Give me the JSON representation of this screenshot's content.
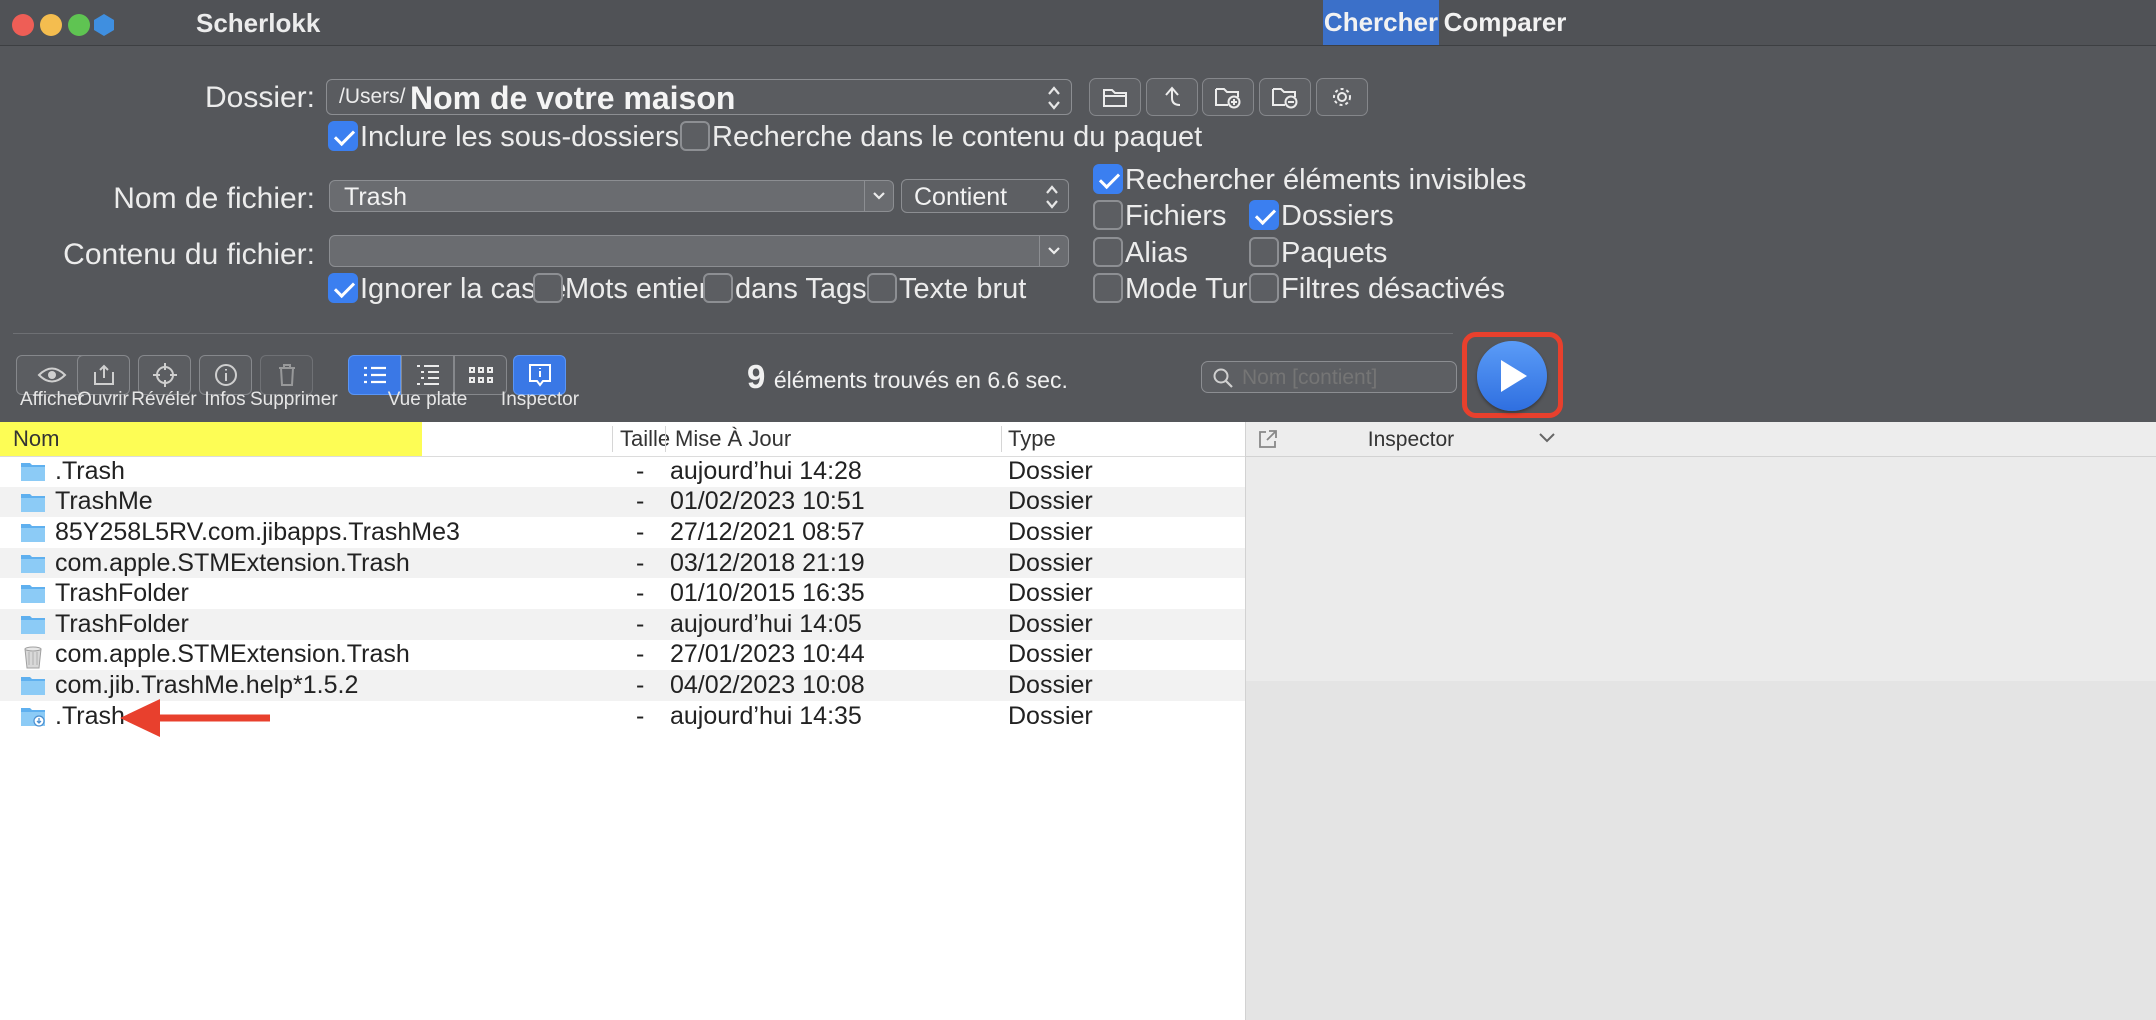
{
  "window": {
    "title": "Scherlokk",
    "tabs": [
      {
        "label": "Chercher",
        "active": true
      },
      {
        "label": "Comparer",
        "active": false
      }
    ]
  },
  "form": {
    "folder": {
      "label": "Dossier:",
      "prefix": "/Users/",
      "value": "Nom de votre maison"
    },
    "include_subfolders": {
      "label": "Inclure les sous-dossiers",
      "checked": true
    },
    "search_package": {
      "label": "Recherche dans le contenu du paquet",
      "checked": false
    },
    "filename": {
      "label": "Nom de fichier:",
      "value": "Trash",
      "mode": "Contient"
    },
    "content": {
      "label": "Contenu du fichier:",
      "value": ""
    },
    "ignore_case": {
      "label": "Ignorer la casse",
      "checked": true
    },
    "whole_words": {
      "label": "Mots entiers",
      "checked": false
    },
    "in_tags": {
      "label": "dans Tags",
      "checked": false
    },
    "plain_text": {
      "label": "Texte brut",
      "checked": false
    },
    "invisible": {
      "label": "Rechercher éléments invisibles",
      "checked": true
    },
    "files": {
      "label": "Fichiers",
      "checked": false
    },
    "folders": {
      "label": "Dossiers",
      "checked": true
    },
    "alias": {
      "label": "Alias",
      "checked": false
    },
    "packages": {
      "label": "Paquets",
      "checked": false
    },
    "turbo": {
      "label": "Mode Turbo",
      "checked": false
    },
    "filters_off": {
      "label": "Filtres désactivés",
      "checked": false
    }
  },
  "toolbar": {
    "show": "Afficher",
    "open": "Ouvrir",
    "reveal": "Révéler",
    "info": "Infos",
    "delete": "Supprimer",
    "flat_view": "Vue plate",
    "inspector": "Inspector",
    "result_count": "9",
    "result_text": "éléments trouvés en 6.6 sec.",
    "filter_placeholder": "Nom [contient]"
  },
  "table": {
    "columns": {
      "name": "Nom",
      "size": "Taille",
      "date": "Mise À Jour",
      "type": "Type"
    },
    "rows": [
      {
        "name": ".Trash",
        "size": "-",
        "date": "aujourd’hui 14:28",
        "type": "Dossier",
        "icon": "folder-icon"
      },
      {
        "name": "TrashMe",
        "size": "-",
        "date": "01/02/2023 10:51",
        "type": "Dossier",
        "icon": "folder-icon"
      },
      {
        "name": "85Y258L5RV.com.jibapps.TrashMe3",
        "size": "-",
        "date": "27/12/2021 08:57",
        "type": "Dossier",
        "icon": "folder-icon"
      },
      {
        "name": "com.apple.STMExtension.Trash",
        "size": "-",
        "date": "03/12/2018 21:19",
        "type": "Dossier",
        "icon": "folder-icon"
      },
      {
        "name": "TrashFolder",
        "size": "-",
        "date": "01/10/2015 16:35",
        "type": "Dossier",
        "icon": "folder-icon"
      },
      {
        "name": "TrashFolder",
        "size": "-",
        "date": "aujourd’hui 14:05",
        "type": "Dossier",
        "icon": "folder-icon"
      },
      {
        "name": "com.apple.STMExtension.Trash",
        "size": "-",
        "date": "27/01/2023 10:44",
        "type": "Dossier",
        "icon": "trash-icon"
      },
      {
        "name": "com.jib.TrashMe.help*1.5.2",
        "size": "-",
        "date": "04/02/2023 10:08",
        "type": "Dossier",
        "icon": "folder-icon"
      },
      {
        "name": ".Trash",
        "size": "-",
        "date": "aujourd’hui 14:35",
        "type": "Dossier",
        "icon": "folder-download-icon"
      }
    ]
  },
  "inspector_panel": {
    "title": "Inspector"
  },
  "colors": {
    "accent": "#3b7ff0",
    "highlight": "#ffff4d",
    "annotation": "#e8402d"
  }
}
